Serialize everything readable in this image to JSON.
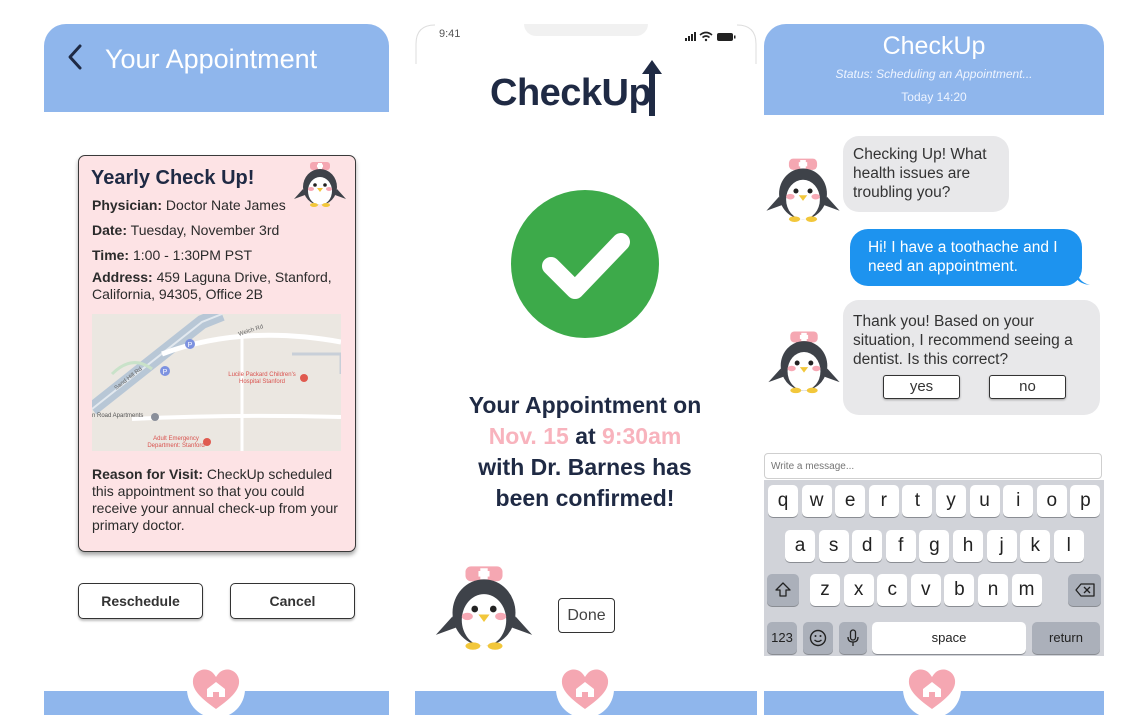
{
  "screen1": {
    "title": "Your Appointment",
    "card": {
      "title": "Yearly Check Up!",
      "physician_label": "Physician:",
      "physician": "Doctor Nate James",
      "date_label": "Date:",
      "date": "Tuesday, November 3rd",
      "time_label": "Time:",
      "time": "1:00 - 1:30PM PST",
      "address_label": "Address:",
      "address": "459 Laguna Drive, Stanford, California, 94305, Office 2B",
      "map_labels": {
        "welch": "Welch Rd",
        "sandhill": "Sand Hill Rd",
        "hospital": "Lucile Packard Children's Hospital Stanford",
        "apartments": "n Road Apartments",
        "emergency": "Adult Emergency Department: Stanford"
      },
      "reason_label": "Reason for Visit:",
      "reason": "CheckUp scheduled this appointment so that you could receive your annual check-up from your primary doctor."
    },
    "reschedule": "Reschedule",
    "cancel": "Cancel"
  },
  "screen2": {
    "status_time": "9:41",
    "logo": "CheckUp",
    "confirm_1": "Your Appointment on",
    "date": "Nov. 15",
    "at": "at",
    "time": "9:30am",
    "with": "with",
    "doctor": "Dr. Barnes",
    "has": "has",
    "confirm_end": "been confirmed!",
    "done": "Done"
  },
  "screen3": {
    "title": "CheckUp",
    "status": "Status: Scheduling an Appointment...",
    "date": "Today 14:20",
    "bot_msg_1": "Checking Up! What health issues are troubling you?",
    "user_msg": "Hi! I have a toothache and I need an appointment.",
    "bot_msg_2": "Thank you! Based on your situation, I recommend seeing a dentist. Is this correct?",
    "yes": "yes",
    "no": "no",
    "input_placeholder": "Write a message...",
    "keyboard": {
      "row1": [
        "q",
        "w",
        "e",
        "r",
        "t",
        "y",
        "u",
        "i",
        "o",
        "p"
      ],
      "row2": [
        "a",
        "s",
        "d",
        "f",
        "g",
        "h",
        "j",
        "k",
        "l"
      ],
      "row3": [
        "z",
        "x",
        "c",
        "v",
        "b",
        "n",
        "m"
      ],
      "num": "123",
      "space": "space",
      "return": "return"
    }
  },
  "colors": {
    "header_blue": "#8fb6ec",
    "card_pink": "#fde3e5",
    "check_green": "#3daa4a",
    "bubble_blue": "#1d93ef",
    "heart_pink": "#f5a7b2",
    "accent_pink": "#f8b3bd"
  }
}
